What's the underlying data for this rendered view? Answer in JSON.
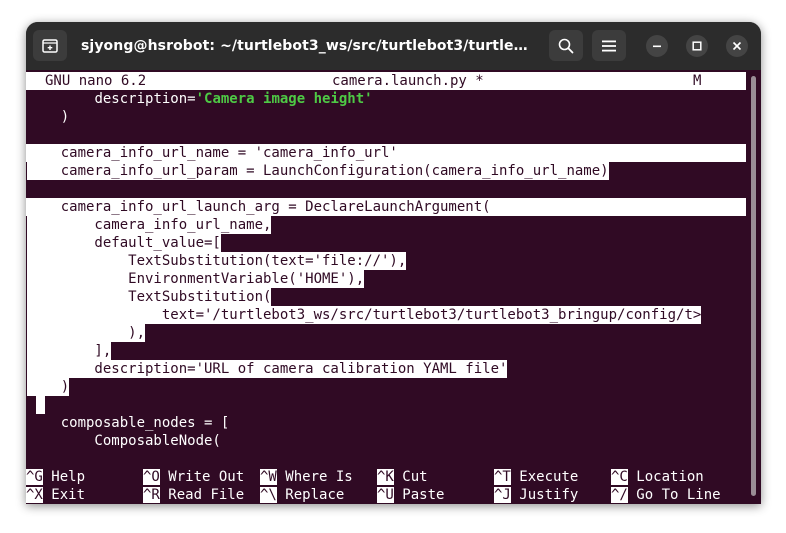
{
  "window": {
    "title": "sjyong@hsrobot: ~/turtlebot3_ws/src/turtlebot3/turtlebot3..."
  },
  "icons": {
    "new_tab": "new-tab-icon",
    "search": "search-icon",
    "menu": "hamburger-menu-icon",
    "minimize": "minimize-icon",
    "maximize": "maximize-icon",
    "close": "close-icon"
  },
  "nano": {
    "version": "GNU nano 6.2",
    "filename": "camera.launch.py *",
    "modified_flag": "M"
  },
  "editor": {
    "line1_indent": "        ",
    "line1_pre": "description=",
    "line1_str": "'Camera image height'",
    "line2": "    )",
    "line4": "    camera_info_url_name = 'camera_info_url'",
    "line5": "    camera_info_url_param = LaunchConfiguration(camera_info_url_name)",
    "line7": "    camera_info_url_launch_arg = DeclareLaunchArgument(",
    "line8": "        camera_info_url_name,",
    "line9": "        default_value=[",
    "line10": "            TextSubstitution(text='file://'),",
    "line11": "            EnvironmentVariable('HOME'),",
    "line12": "            TextSubstitution(",
    "line13": "                text='/turtlebot3_ws/src/turtlebot3/turtlebot3_bringup/config/t>",
    "line14": "            ),",
    "line15": "        ],",
    "line16": "        description='URL of camera calibration YAML file'",
    "line17": "    )",
    "line19": "    composable_nodes = [",
    "line20": "        ComposableNode("
  },
  "shortcuts": [
    {
      "key": "^G",
      "label": "Help"
    },
    {
      "key": "^O",
      "label": "Write Out"
    },
    {
      "key": "^W",
      "label": "Where Is"
    },
    {
      "key": "^K",
      "label": "Cut"
    },
    {
      "key": "^T",
      "label": "Execute"
    },
    {
      "key": "^C",
      "label": "Location"
    },
    {
      "key": "^X",
      "label": "Exit"
    },
    {
      "key": "^R",
      "label": "Read File"
    },
    {
      "key": "^\\",
      "label": "Replace"
    },
    {
      "key": "^U",
      "label": "Paste"
    },
    {
      "key": "^J",
      "label": "Justify"
    },
    {
      "key": "^/",
      "label": "Go To Line"
    }
  ],
  "colors": {
    "terminal_bg": "#300a24",
    "titlebar_bg": "#2c2c2c",
    "string_green": "#4ec945",
    "selection": "#ffffff"
  }
}
